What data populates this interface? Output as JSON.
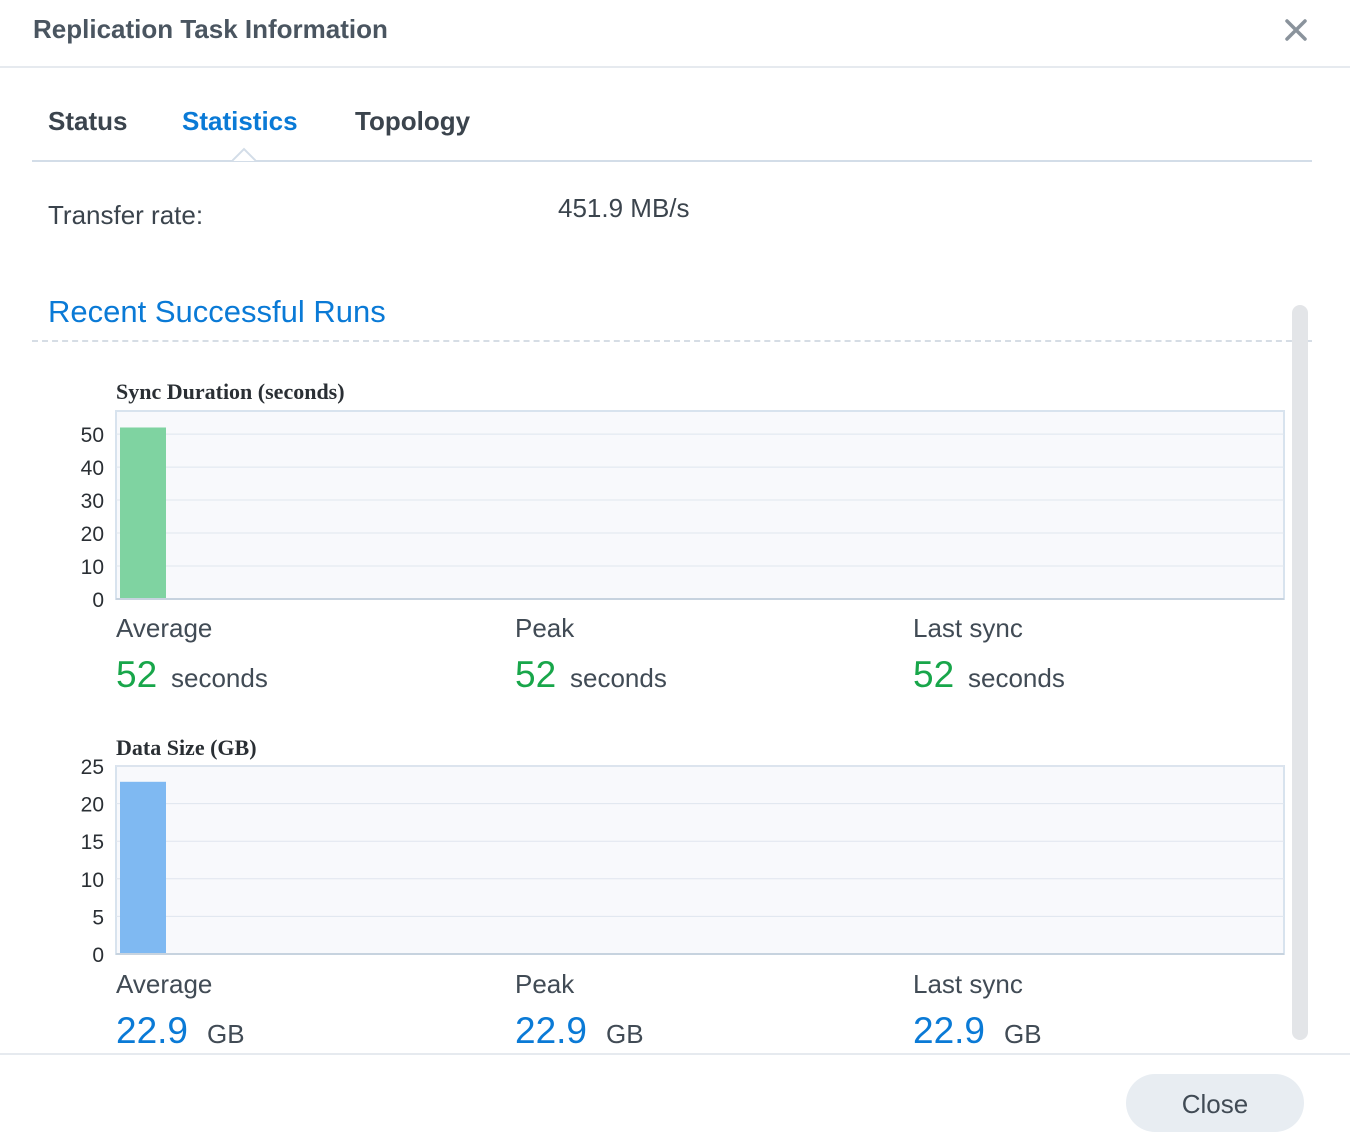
{
  "window": {
    "title": "Replication Task Information"
  },
  "tabs": [
    {
      "label": "Status",
      "active": false
    },
    {
      "label": "Statistics",
      "active": true
    },
    {
      "label": "Topology",
      "active": false
    }
  ],
  "transfer": {
    "label": "Transfer rate:",
    "value": "451.9 MB/s"
  },
  "section": {
    "title": "Recent Successful Runs"
  },
  "sync_stats": [
    {
      "label": "Average",
      "value": "52",
      "unit": "seconds"
    },
    {
      "label": "Peak",
      "value": "52",
      "unit": "seconds"
    },
    {
      "label": "Last sync",
      "value": "52",
      "unit": "seconds"
    }
  ],
  "size_stats": [
    {
      "label": "Average",
      "value": "22.9",
      "unit": "GB"
    },
    {
      "label": "Peak",
      "value": "22.9",
      "unit": "GB"
    },
    {
      "label": "Last sync",
      "value": "22.9",
      "unit": "GB"
    }
  ],
  "footer": {
    "close_label": "Close"
  },
  "colors": {
    "accent": "#0a7ad6",
    "green": "#18a64a",
    "sync_bar": "#7fd3a1",
    "size_bar": "#7fb9f2"
  },
  "chart_data": [
    {
      "type": "bar",
      "title": "Sync Duration (seconds)",
      "categories": [
        ""
      ],
      "values": [
        52
      ],
      "ylim": [
        0,
        57
      ],
      "yticks": [
        0,
        10,
        20,
        30,
        40,
        50
      ],
      "grid": true,
      "color": "#7fd3a1"
    },
    {
      "type": "bar",
      "title": "Data Size (GB)",
      "categories": [
        ""
      ],
      "values": [
        22.9
      ],
      "ylim": [
        0,
        25
      ],
      "yticks": [
        0,
        5,
        10,
        15,
        20,
        25
      ],
      "grid": true,
      "color": "#7fb9f2"
    }
  ]
}
